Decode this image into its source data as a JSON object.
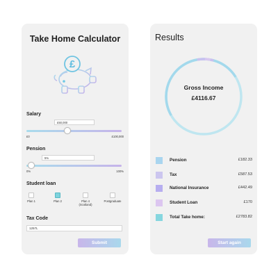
{
  "calculator": {
    "title": "Take Home Calculator",
    "salary": {
      "label": "Salary",
      "value": "£50,000",
      "min_label": "£0",
      "max_label": "£100,000",
      "fraction": 0.43
    },
    "pension": {
      "label": "Pension",
      "value": "5%",
      "min_label": "0%",
      "max_label": "100%",
      "fraction": 0.05
    },
    "student_loan": {
      "label": "Student loan",
      "options": [
        {
          "line1": "Plan 1",
          "line2": "",
          "checked": false
        },
        {
          "line1": "Plan 2",
          "line2": "",
          "checked": true
        },
        {
          "line1": "Plan 4",
          "line2": "(Scotland)",
          "checked": false
        },
        {
          "line1": "Postgraduate",
          "line2": "",
          "checked": false
        }
      ]
    },
    "tax_code": {
      "label": "Tax Code",
      "value": "1257L"
    },
    "submit_label": "Submit",
    "icon": "piggy-bank-pound-icon"
  },
  "results": {
    "title": "Results",
    "gross_label": "Gross Income",
    "gross_value": "£4116.67",
    "rows": [
      {
        "label": "Pension",
        "value": "£182.33",
        "color": "#a9d5ef"
      },
      {
        "label": "Tax",
        "value": "£587.53",
        "color": "#ccc6ef"
      },
      {
        "label": "National Insurance",
        "value": "£442.49",
        "color": "#b7aef0"
      },
      {
        "label": "Student Loan",
        "value": "£170",
        "color": "#dcc6f0"
      },
      {
        "label": "Total Take home:",
        "value": "£2783.82",
        "color": "#86d6df"
      }
    ],
    "start_again_label": "Start again"
  },
  "colors": {
    "accent_blue": "#a9dcec",
    "accent_purple": "#c6b3ea",
    "teal": "#7fd2dc"
  }
}
